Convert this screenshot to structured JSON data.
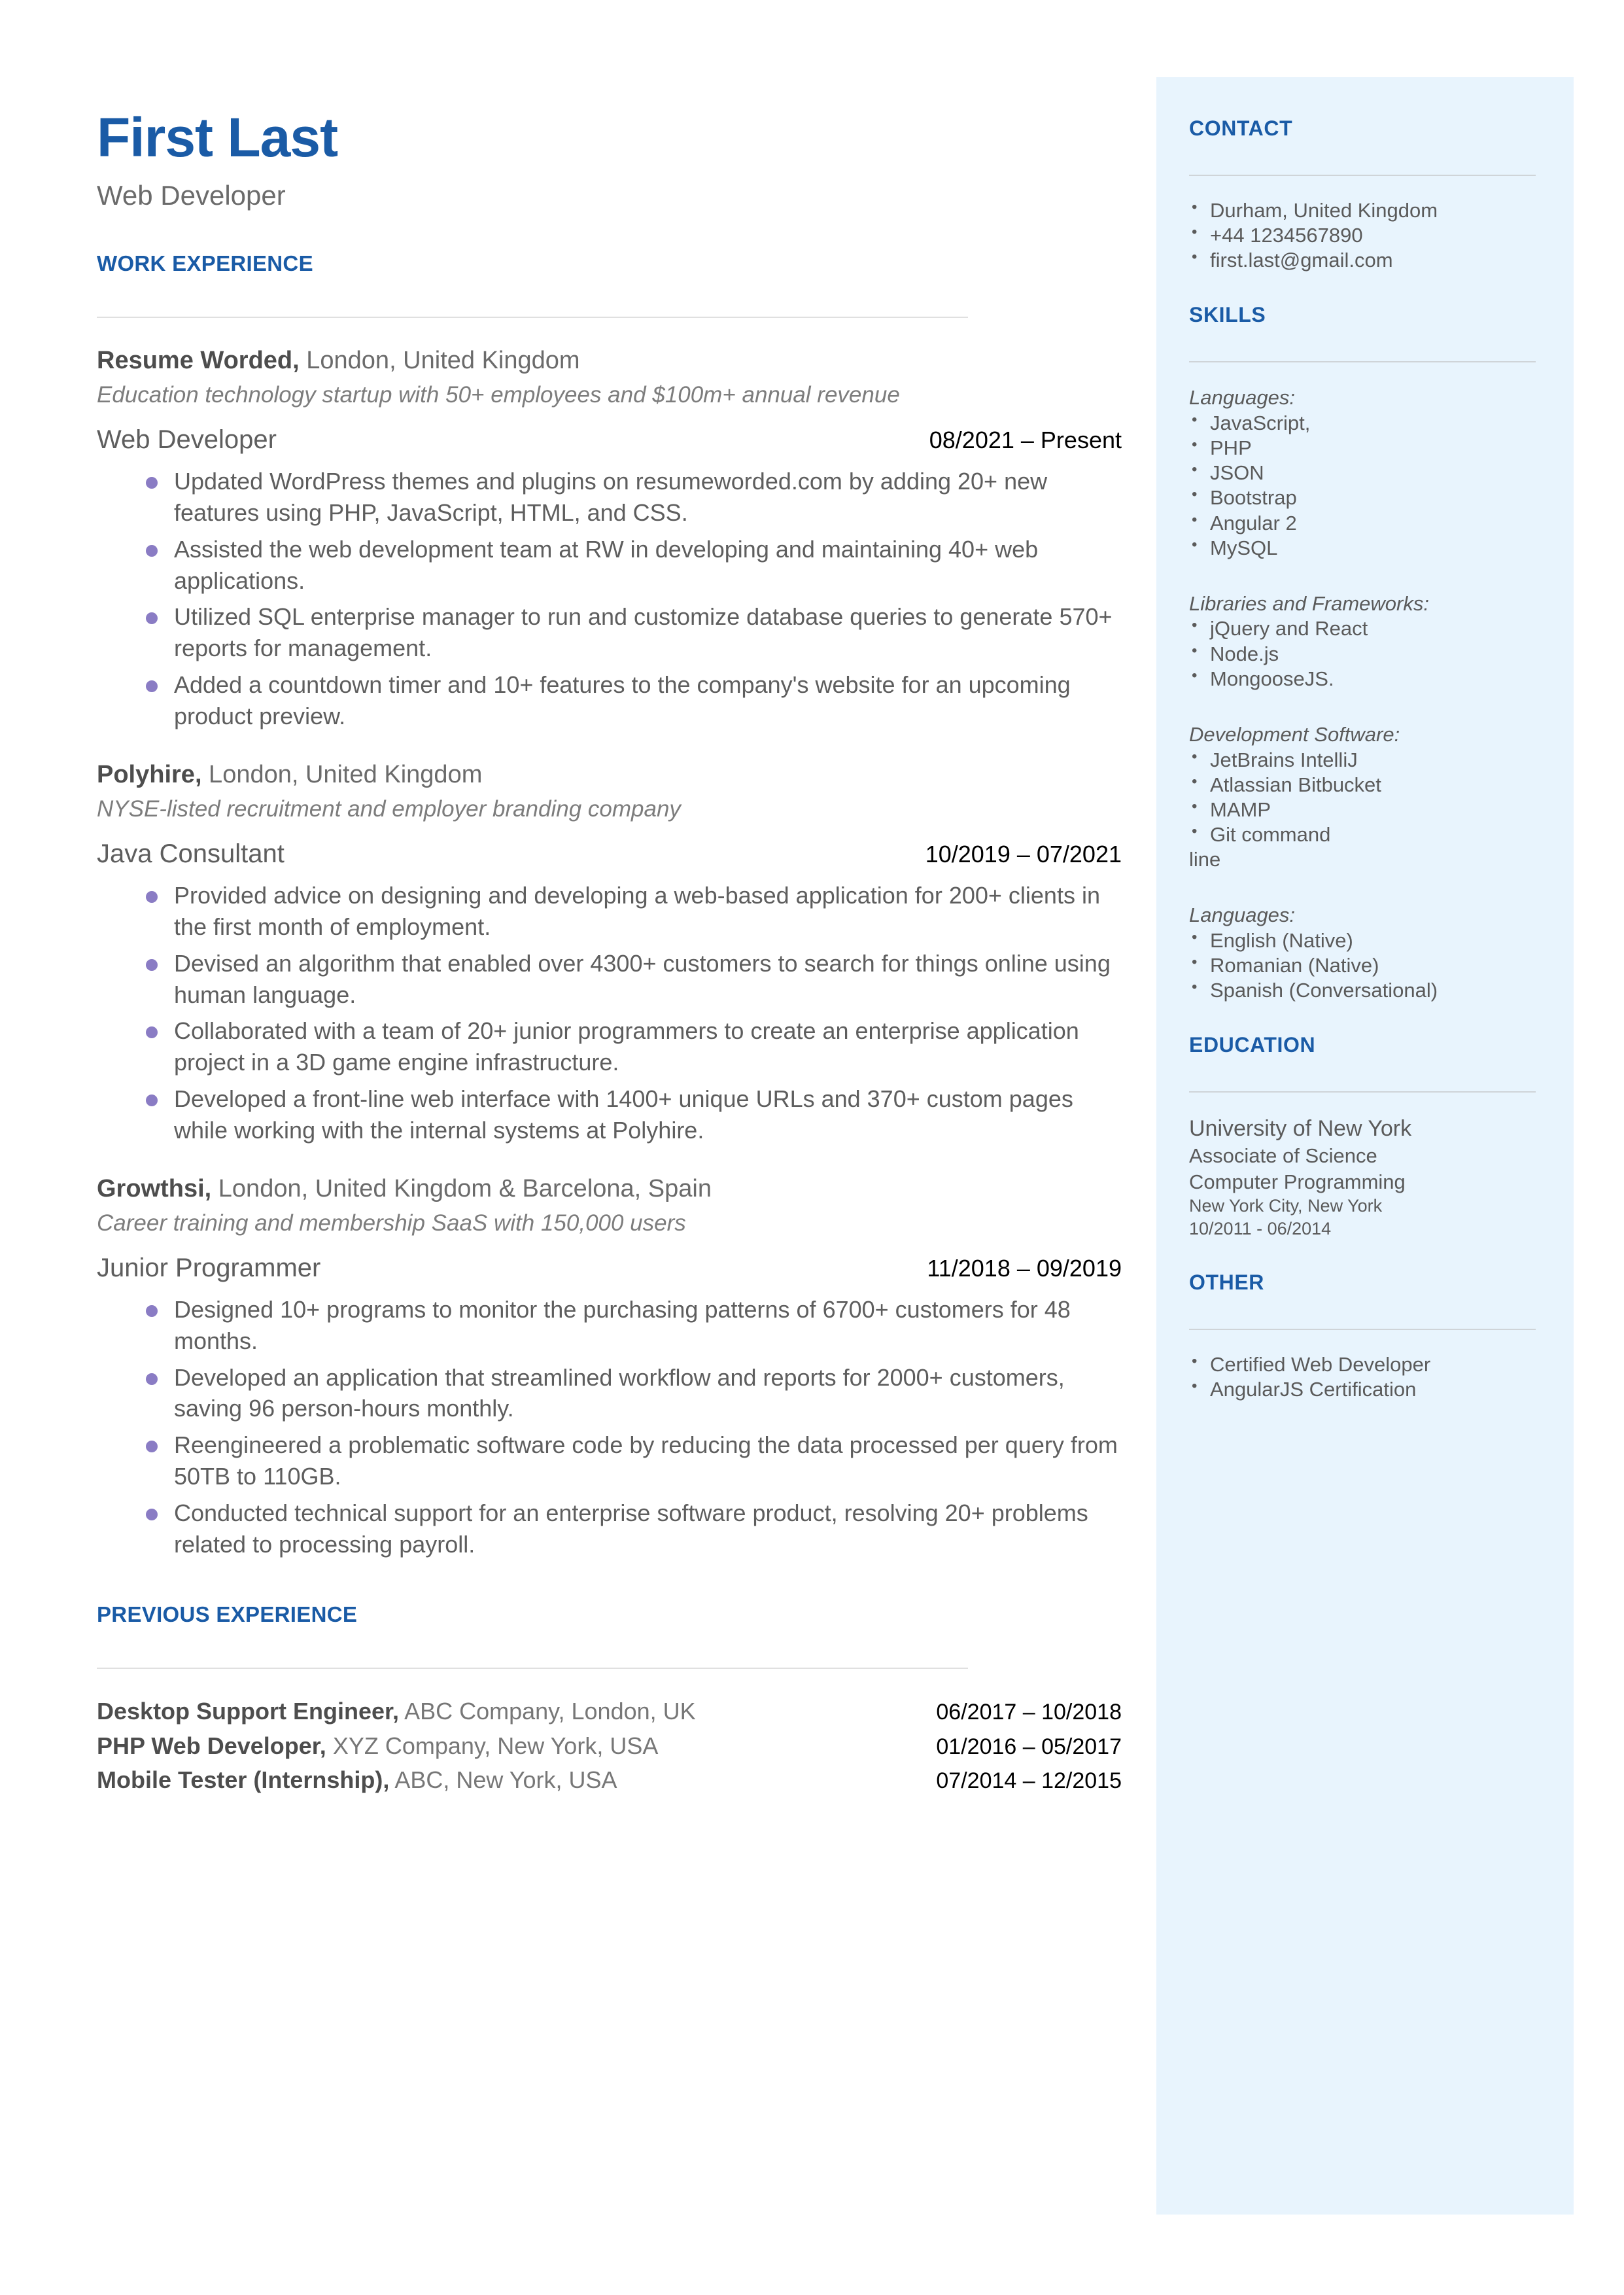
{
  "header": {
    "name": "First Last",
    "title": "Web Developer"
  },
  "colors": {
    "accent": "#1a5ba6",
    "sidebar_bg": "#e8f4fd",
    "bullet": "#8a7cc4",
    "body_text": "#5e5e5e"
  },
  "main": {
    "work_experience_heading": "WORK EXPERIENCE",
    "previous_experience_heading": "PREVIOUS EXPERIENCE",
    "jobs": [
      {
        "company": "Resume Worded,",
        "location": " London, United Kingdom",
        "blurb": "Education technology startup with 50+ employees and $100m+ annual revenue",
        "role": "Web Developer",
        "dates": "08/2021 – Present",
        "bullets": [
          "Updated WordPress themes and plugins on resumeworded.com by adding 20+ new features using PHP, JavaScript, HTML, and CSS.",
          "Assisted the web development team at RW in developing and maintaining 40+ web applications.",
          "Utilized SQL enterprise manager to run and customize database queries to generate 570+ reports for management.",
          "Added a countdown timer and 10+ features to the company's website for an upcoming product preview."
        ]
      },
      {
        "company": "Polyhire,",
        "location": " London, United Kingdom",
        "blurb": "NYSE-listed recruitment and employer branding company",
        "role": "Java Consultant",
        "dates": "10/2019 – 07/2021",
        "bullets": [
          "Provided advice on designing and developing a web-based application for 200+ clients in the first month of employment.",
          "Devised an algorithm that enabled over 4300+ customers to search for things online using human language.",
          "Collaborated with a team of 20+ junior programmers to create an enterprise application project in a 3D game engine infrastructure.",
          "Developed a front-line web interface with  1400+ unique URLs and 370+ custom pages while working with the internal systems at Polyhire."
        ]
      },
      {
        "company": "Growthsi,",
        "location": " London, United Kingdom & Barcelona, Spain",
        "blurb": "Career training and membership SaaS with 150,000 users",
        "role": "Junior Programmer",
        "dates": "11/2018 – 09/2019",
        "bullets": [
          "Designed 10+ programs to monitor the purchasing patterns of 6700+ customers for 48 months.",
          "Developed an application that streamlined workflow and reports for 2000+ customers, saving 96 person-hours monthly.",
          "Reengineered a problematic software code by reducing the data processed per query from 50TB to 110GB.",
          "Conducted technical support for an enterprise software product, resolving 20+ problems related to processing payroll."
        ]
      }
    ],
    "previous_jobs": [
      {
        "role": "Desktop Support Engineer,",
        "detail": " ABC Company, London, UK",
        "dates": "06/2017 – 10/2018"
      },
      {
        "role": "PHP Web Developer,",
        "detail": " XYZ Company, New York, USA",
        "dates": "01/2016 – 05/2017"
      },
      {
        "role": "Mobile Tester (Internship),",
        "detail": " ABC, New York, USA",
        "dates": "07/2014 – 12/2015"
      }
    ]
  },
  "sidebar": {
    "contact": {
      "heading": "CONTACT",
      "items": [
        " Durham, United Kingdom",
        "+44 1234567890",
        "first.last@gmail.com"
      ]
    },
    "skills": {
      "heading": "SKILLS",
      "groups": [
        {
          "label": "Languages:",
          "items": [
            "JavaScript,",
            "PHP",
            "JSON",
            "Bootstrap",
            "Angular 2",
            "MySQL"
          ],
          "overflow": ""
        },
        {
          "label": "Libraries and Frameworks:",
          "items": [
            "jQuery and React",
            "Node.js",
            "MongooseJS."
          ],
          "overflow": ""
        },
        {
          "label": "Development Software:",
          "items": [
            "JetBrains IntelliJ",
            "Atlassian Bitbucket",
            "MAMP",
            "Git command"
          ],
          "overflow": "line"
        },
        {
          "label": "Languages:",
          "items": [
            "English (Native)",
            "Romanian (Native)",
            "Spanish (Conversational)"
          ],
          "overflow": ""
        }
      ]
    },
    "education": {
      "heading": "EDUCATION",
      "school": "University of New York",
      "degree": "Associate of Science",
      "field": "Computer Programming",
      "location": "New York City, New York",
      "dates": "10/2011 - 06/2014"
    },
    "other": {
      "heading": "OTHER",
      "items": [
        "Certified Web Developer",
        "AngularJS Certification"
      ]
    }
  }
}
